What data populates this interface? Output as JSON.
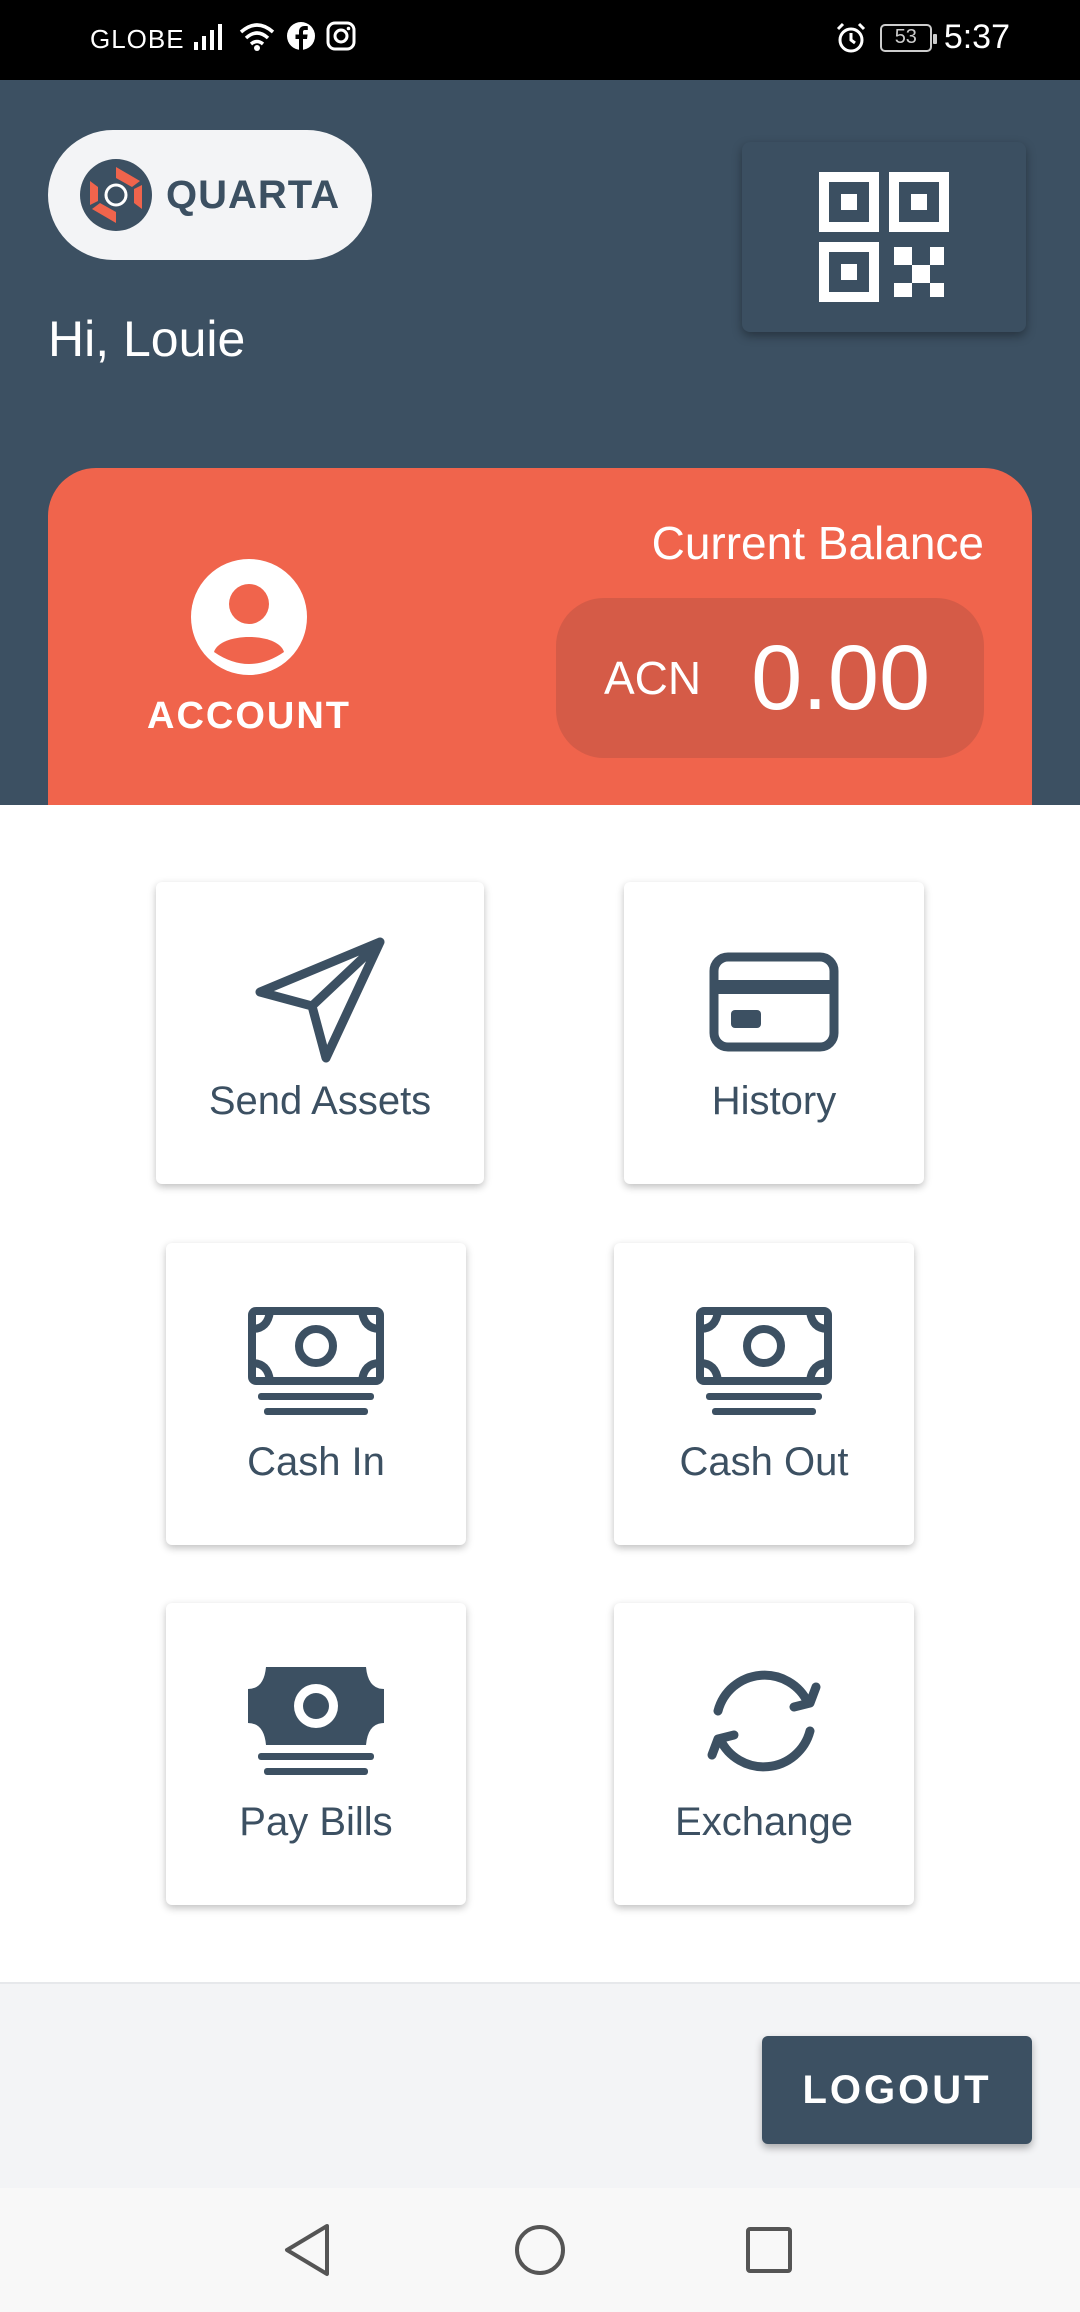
{
  "status_bar": {
    "carrier": "GLOBE",
    "battery": "53",
    "time": "5:37"
  },
  "header": {
    "logo_text": "QUARTA",
    "greeting": "Hi, Louie"
  },
  "balance": {
    "account_label": "ACCOUNT",
    "current_balance_label": "Current Balance",
    "currency": "ACN",
    "amount": "0.00"
  },
  "actions": [
    {
      "label": "Send Assets",
      "icon": "send-icon"
    },
    {
      "label": "History",
      "icon": "card-icon"
    },
    {
      "label": "Cash In",
      "icon": "cash-icon"
    },
    {
      "label": "Cash Out",
      "icon": "cash-icon"
    },
    {
      "label": "Pay Bills",
      "icon": "cash-filled-icon"
    },
    {
      "label": "Exchange",
      "icon": "sync-icon"
    }
  ],
  "footer": {
    "logout_label": "LOGOUT"
  },
  "colors": {
    "primary": "#3c5062",
    "accent": "#f0644c",
    "accent_dark": "#d55b47"
  }
}
